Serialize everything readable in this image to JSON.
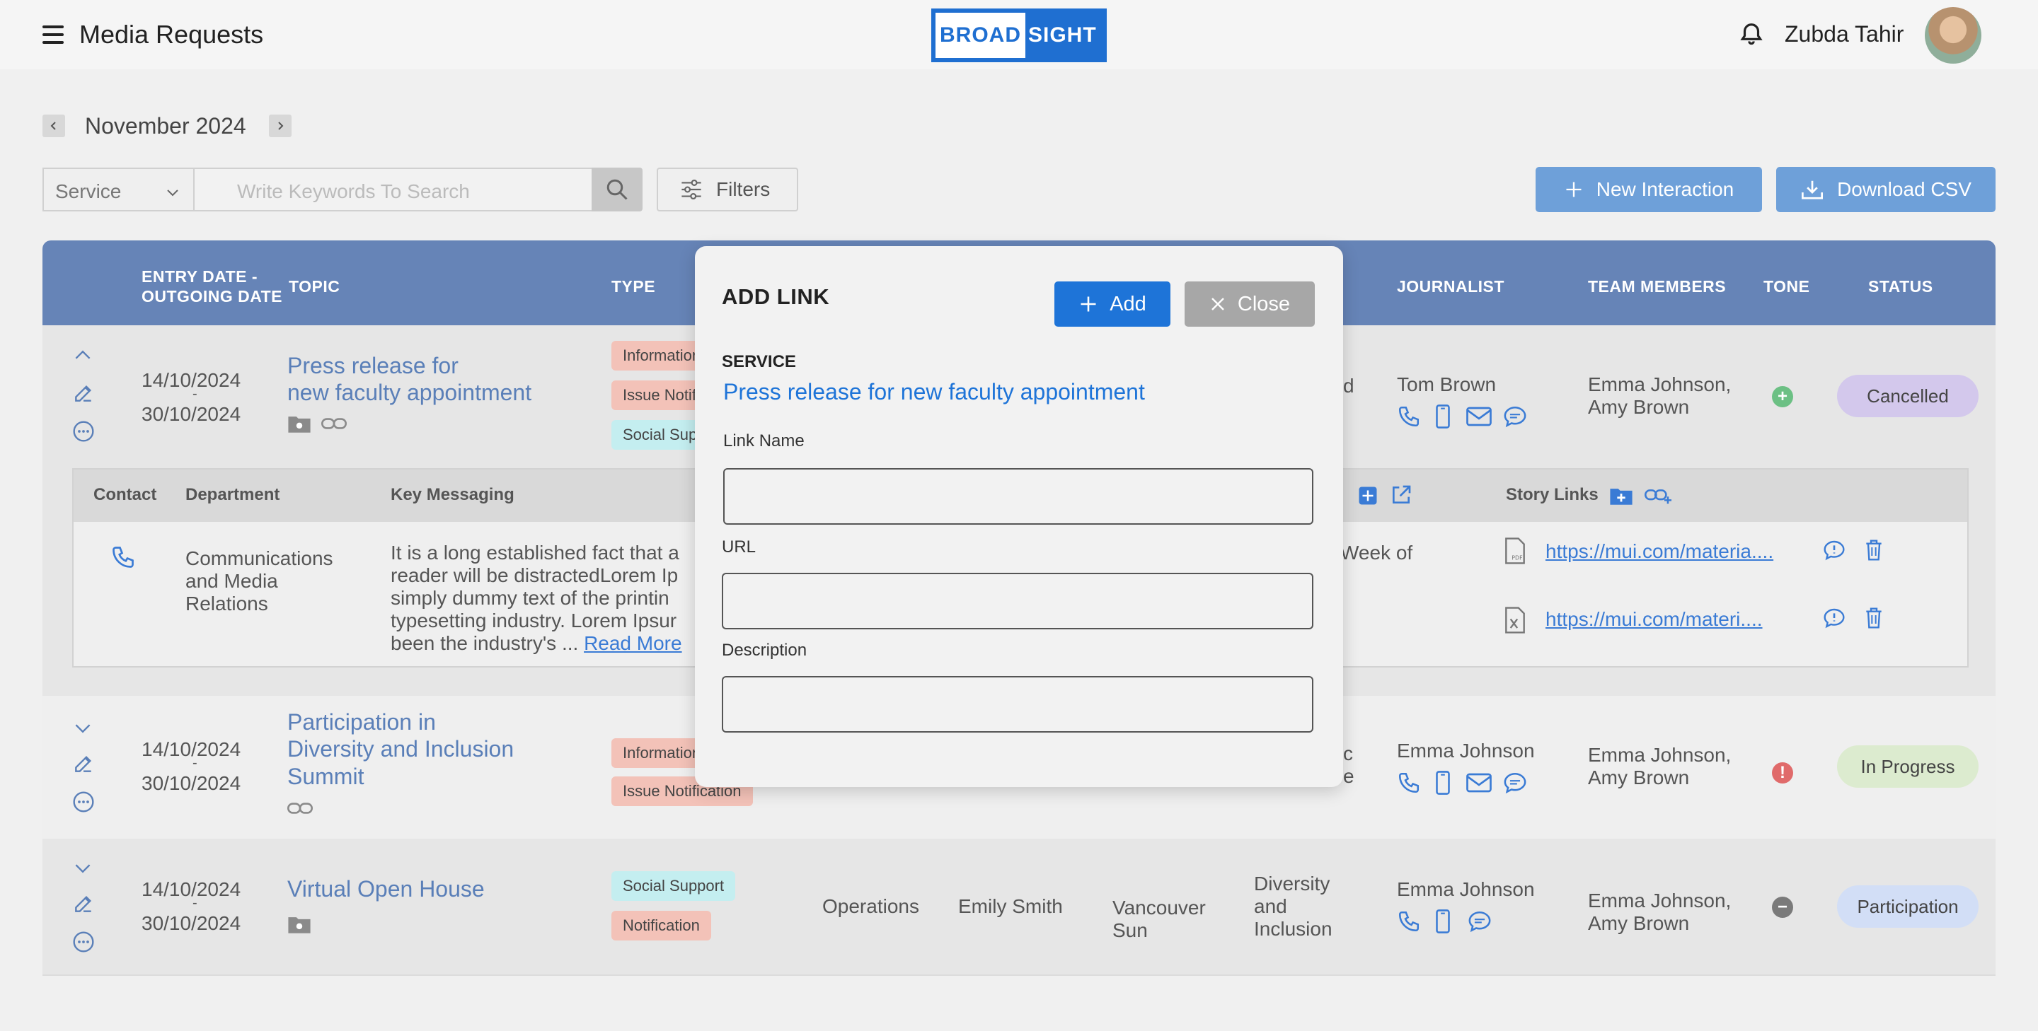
{
  "header": {
    "app_title": "Media Requests",
    "logo_part1": "BROAD",
    "logo_part2": "SIGHT",
    "user_name": "Zubda Tahir"
  },
  "date_nav": {
    "month": "November 2024"
  },
  "search": {
    "service_value": "Service",
    "placeholder": "Write Keywords To Search",
    "filters_label": "Filters"
  },
  "actions": {
    "new_interaction": "New Interaction",
    "download_csv": "Download CSV"
  },
  "table": {
    "headers": {
      "entry_date": "ENTRY DATE -",
      "outgoing_date": "OUTGOING DATE",
      "topic": "TOPIC",
      "type": "TYPE",
      "journalist": "JOURNALIST",
      "team_members": "TEAM MEMBERS",
      "tone": "TONE",
      "status": "STATUS"
    },
    "rows": [
      {
        "entry": "14/10/2024",
        "sep": "-",
        "outgoing": "30/10/2024",
        "topic_line1": "Press release for",
        "topic_line2": "new faculty appointment",
        "types": [
          "Information",
          "Issue Notification",
          "Social Support"
        ],
        "col_partial": "d",
        "journalist": "Tom Brown",
        "team_line1": "Emma Johnson,",
        "team_line2": "Amy Brown",
        "tone": "+",
        "status": "Cancelled",
        "status_color": "#d3c8ec"
      },
      {
        "entry": "14/10/2024",
        "sep": "-",
        "outgoing": "30/10/2024",
        "topic_line1": "Participation in",
        "topic_line2": "Diversity and Inclusion",
        "topic_line3": "Summit",
        "types": [
          "Information",
          "Issue Notification"
        ],
        "col_partial1": "c",
        "col_partial2": "e",
        "journalist": "Emma Johnson",
        "team_line1": "Emma Johnson,",
        "team_line2": "Amy Brown",
        "tone": "!",
        "status": "In Progress",
        "status_color": "#dcebcf"
      },
      {
        "entry": "14/10/2024",
        "sep": "-",
        "outgoing": "30/10/2024",
        "topic_line1": "Virtual Open House",
        "types": [
          "Social Support",
          "Notification"
        ],
        "department": "Operations",
        "contact": "Emily Smith",
        "outlet_line1": "Vancouver",
        "outlet_line2": "Sun",
        "category_line1": "Diversity",
        "category_line2": "and",
        "category_line3": "Inclusion",
        "journalist": "Emma Johnson",
        "team_line1": "Emma Johnson,",
        "team_line2": "Amy Brown",
        "tone": "−",
        "status": "Participation",
        "status_color": "#d2def6"
      }
    ]
  },
  "subpanel": {
    "headers": {
      "contact": "Contact",
      "department": "Department",
      "key_messaging": "Key Messaging",
      "story_links": "Story Links"
    },
    "department_line1": "Communications",
    "department_line2": "and Media",
    "department_line3": "Relations",
    "msg_line1": "It is a long established fact that a",
    "msg_line2": "reader will be distractedLorem Ip",
    "msg_line3": "simply dummy text of the printin",
    "msg_line4": "typesetting industry. Lorem Ipsur",
    "msg_line5": "been the industry's ...",
    "read_more": "Read More",
    "partial_text": "ly/Week of",
    "link1": "https://mui.com/materia....",
    "link2": "https://mui.com/materi...."
  },
  "modal": {
    "title": "ADD LINK",
    "add_label": "Add",
    "close_label": "Close",
    "service_label": "SERVICE",
    "service_value": "Press release for new faculty appointment",
    "link_name_label": "Link Name",
    "url_label": "URL",
    "description_label": "Description"
  },
  "colors": {
    "header_blue": "#6684b7",
    "primary": "#1e74d8",
    "tone_positive": "#6cc084",
    "tone_negative": "#e06a6a",
    "tone_neutral": "#7a7a7a"
  }
}
